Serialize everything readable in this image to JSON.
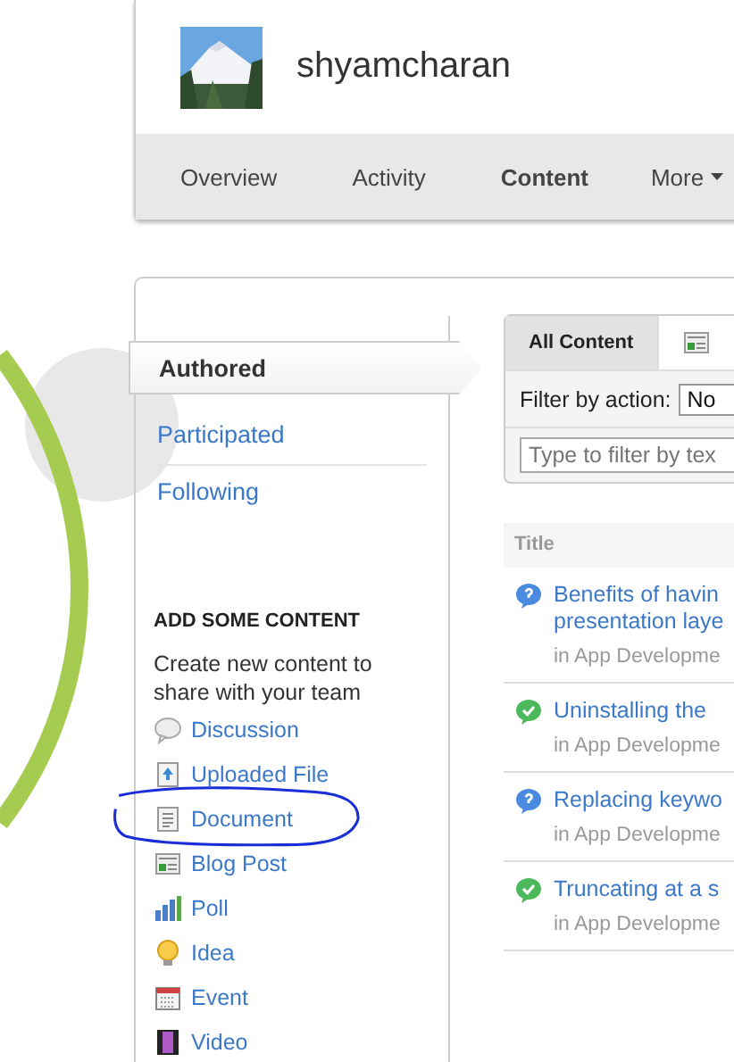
{
  "profile": {
    "name": "shyamcharan"
  },
  "nav": [
    {
      "label": "Overview",
      "selected": false
    },
    {
      "label": "Activity",
      "selected": false
    },
    {
      "label": "Content",
      "selected": true
    },
    {
      "label": "More",
      "selected": false,
      "dropdown": true
    }
  ],
  "filters": [
    {
      "label": "Authored",
      "selected": true
    },
    {
      "label": "Participated",
      "selected": false
    },
    {
      "label": "Following",
      "selected": false
    }
  ],
  "add_content": {
    "heading": "ADD SOME CONTENT",
    "text": "Create new content to share with your team",
    "items": [
      {
        "label": "Discussion",
        "kind": "discussion"
      },
      {
        "label": "Uploaded File",
        "kind": "file"
      },
      {
        "label": "Document",
        "kind": "document",
        "circled": true
      },
      {
        "label": "Blog Post",
        "kind": "blog"
      },
      {
        "label": "Poll",
        "kind": "poll"
      },
      {
        "label": "Idea",
        "kind": "idea"
      },
      {
        "label": "Event",
        "kind": "event"
      },
      {
        "label": "Video",
        "kind": "video"
      }
    ]
  },
  "content_tabs": [
    {
      "label": "All Content",
      "kind": "text",
      "selected": true
    },
    {
      "kind": "blog",
      "selected": false
    }
  ],
  "filter_by_action": {
    "label": "Filter by action:",
    "value": "No"
  },
  "text_filter": {
    "placeholder": "Type to filter by tex"
  },
  "table": {
    "columns": [
      "Title"
    ],
    "rows": [
      {
        "kind": "question",
        "title": [
          "Benefits of havin",
          "presentation laye"
        ],
        "place": "in App Developme"
      },
      {
        "kind": "answered",
        "title": [
          "Uninstalling the"
        ],
        "place": "in App Developme"
      },
      {
        "kind": "question",
        "title": [
          "Replacing keywo"
        ],
        "place": "in App Developme"
      },
      {
        "kind": "answered",
        "title": [
          "Truncating at a s"
        ],
        "place": "in App Developme"
      }
    ]
  }
}
